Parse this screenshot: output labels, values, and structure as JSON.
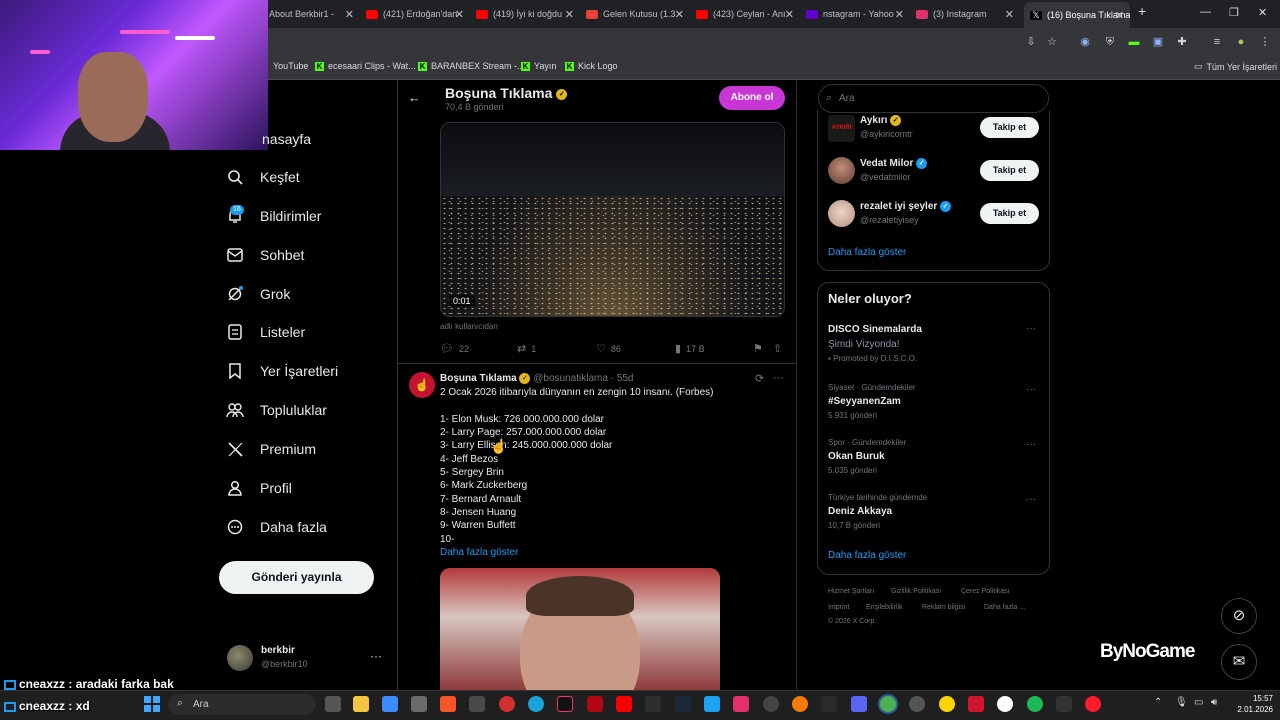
{
  "browser": {
    "tabs": [
      {
        "label": "About Berkbir1 - "
      },
      {
        "label": "(421) Erdoğan'dan"
      },
      {
        "label": "(419) İyi ki doğdu"
      },
      {
        "label": "Gelen Kutusu (1.3"
      },
      {
        "label": "(423) Ceylan - Anı"
      },
      {
        "label": "nstagram - Yahoo"
      },
      {
        "label": "(3) Instagram"
      },
      {
        "label": "(16) Boşuna Tıklama"
      }
    ],
    "bookmarks": [
      "YouTube",
      "ecesaari Clips - Wat...",
      "BARANBEX Stream -...",
      "Yayın",
      "Kick Logo"
    ],
    "all_bookmarks_label": "Tüm Yer İşaretleri"
  },
  "nav": {
    "home_partial": "nasayfa",
    "items": [
      {
        "label": "Keşfet",
        "icon": "search-icon"
      },
      {
        "label": "Bildirimler",
        "icon": "bell-icon"
      },
      {
        "label": "Sohbet",
        "icon": "mail-icon"
      },
      {
        "label": "Grok",
        "icon": "grok-icon"
      },
      {
        "label": "Listeler",
        "icon": "list-icon"
      },
      {
        "label": "Yer İşaretleri",
        "icon": "bookmark-icon"
      },
      {
        "label": "Topluluklar",
        "icon": "communities-icon"
      },
      {
        "label": "Premium",
        "icon": "x-logo-icon"
      },
      {
        "label": "Profil",
        "icon": "profile-icon"
      },
      {
        "label": "Daha fazla",
        "icon": "more-circle-icon"
      }
    ],
    "notif_badge": "16",
    "post_button": "Gönderi yayınla",
    "account": {
      "name": "berkbir",
      "handle": "@berkbir10"
    }
  },
  "header": {
    "title": "Boşuna Tıklama",
    "subtitle": "70,4 B gönderi",
    "subscribe": "Abone ol"
  },
  "video_post": {
    "duration": "0:01",
    "hidden_name": "adlı kullanıcıdan",
    "replies": "22",
    "reposts": "1",
    "likes": "86",
    "views": "17 B"
  },
  "tweet": {
    "author": "Boşuna Tıklama",
    "handle": "@bosunatiklama",
    "time": "55d",
    "intro": "2 Ocak 2026 itibarıyla dünyanın en zengin 10 insanı. (Forbes)",
    "list": [
      "1- Elon Musk: 726.000.000.000 dolar",
      "2- Larry Page: 257.000.000.000 dolar",
      "3- Larry Ellison: 245.000.000.000 dolar",
      "4- Jeff Bezos",
      "5- Sergey Brin",
      "6- Mark Zuckerberg",
      "7- Bernard Arnault",
      "8- Jensen Huang",
      "9- Warren Buffett",
      "10-"
    ],
    "show_more": "Daha fazla göster"
  },
  "right": {
    "search_placeholder": "Ara",
    "who_to_follow": [
      {
        "name": "Aykırı",
        "handle": "@aykiricomtr",
        "button": "Takip et",
        "avatar_text": "AYKIRI"
      },
      {
        "name": "Vedat Milor",
        "handle": "@vedatmilor",
        "button": "Takip et"
      },
      {
        "name": "rezalet iyi şeyler",
        "handle": "@rezaletiyisey",
        "button": "Takip et"
      }
    ],
    "wtf_more": "Daha fazla göster",
    "trends_title": "Neler oluyor?",
    "trends": [
      {
        "category": "",
        "name": "DISCO Sinemalarda",
        "sub": "Şimdi Vizyonda!",
        "promo": "Promoted by D.I.S.C.O."
      },
      {
        "category": "Siyaset · Gündemdekiler",
        "name": "#SeyyanenZam",
        "count": "5.931 gönderi"
      },
      {
        "category": "Spor · Gündemdekiler",
        "name": "Okan Buruk",
        "count": "5.035 gönderi"
      },
      {
        "category": "Türkiye tarihinde gündemde",
        "name": "Deniz Akkaya",
        "count": "10,7 B gönderi"
      }
    ],
    "trends_more": "Daha fazla göster",
    "footer": [
      "Hizmet Şartları",
      "Gizlilik Politikası",
      "Çerez Politikası",
      "Imprint",
      "Erişilebilirlik",
      "Reklam bilgisi",
      "Daha fazla ...",
      "© 2026 X Corp."
    ]
  },
  "overlay": {
    "chat": [
      {
        "user": "cneaxzz",
        "msg": "aradaki farka bak"
      },
      {
        "user": "cneaxzz",
        "msg": "xd"
      }
    ],
    "brand": "ByNoGame"
  },
  "taskbar": {
    "search": "Ara",
    "time": "15:57",
    "date": "2.01.2026"
  },
  "colors": {
    "accent": "#1d9bf0",
    "subscribe": "#c936d6",
    "verified_gold": "#e2b719"
  }
}
